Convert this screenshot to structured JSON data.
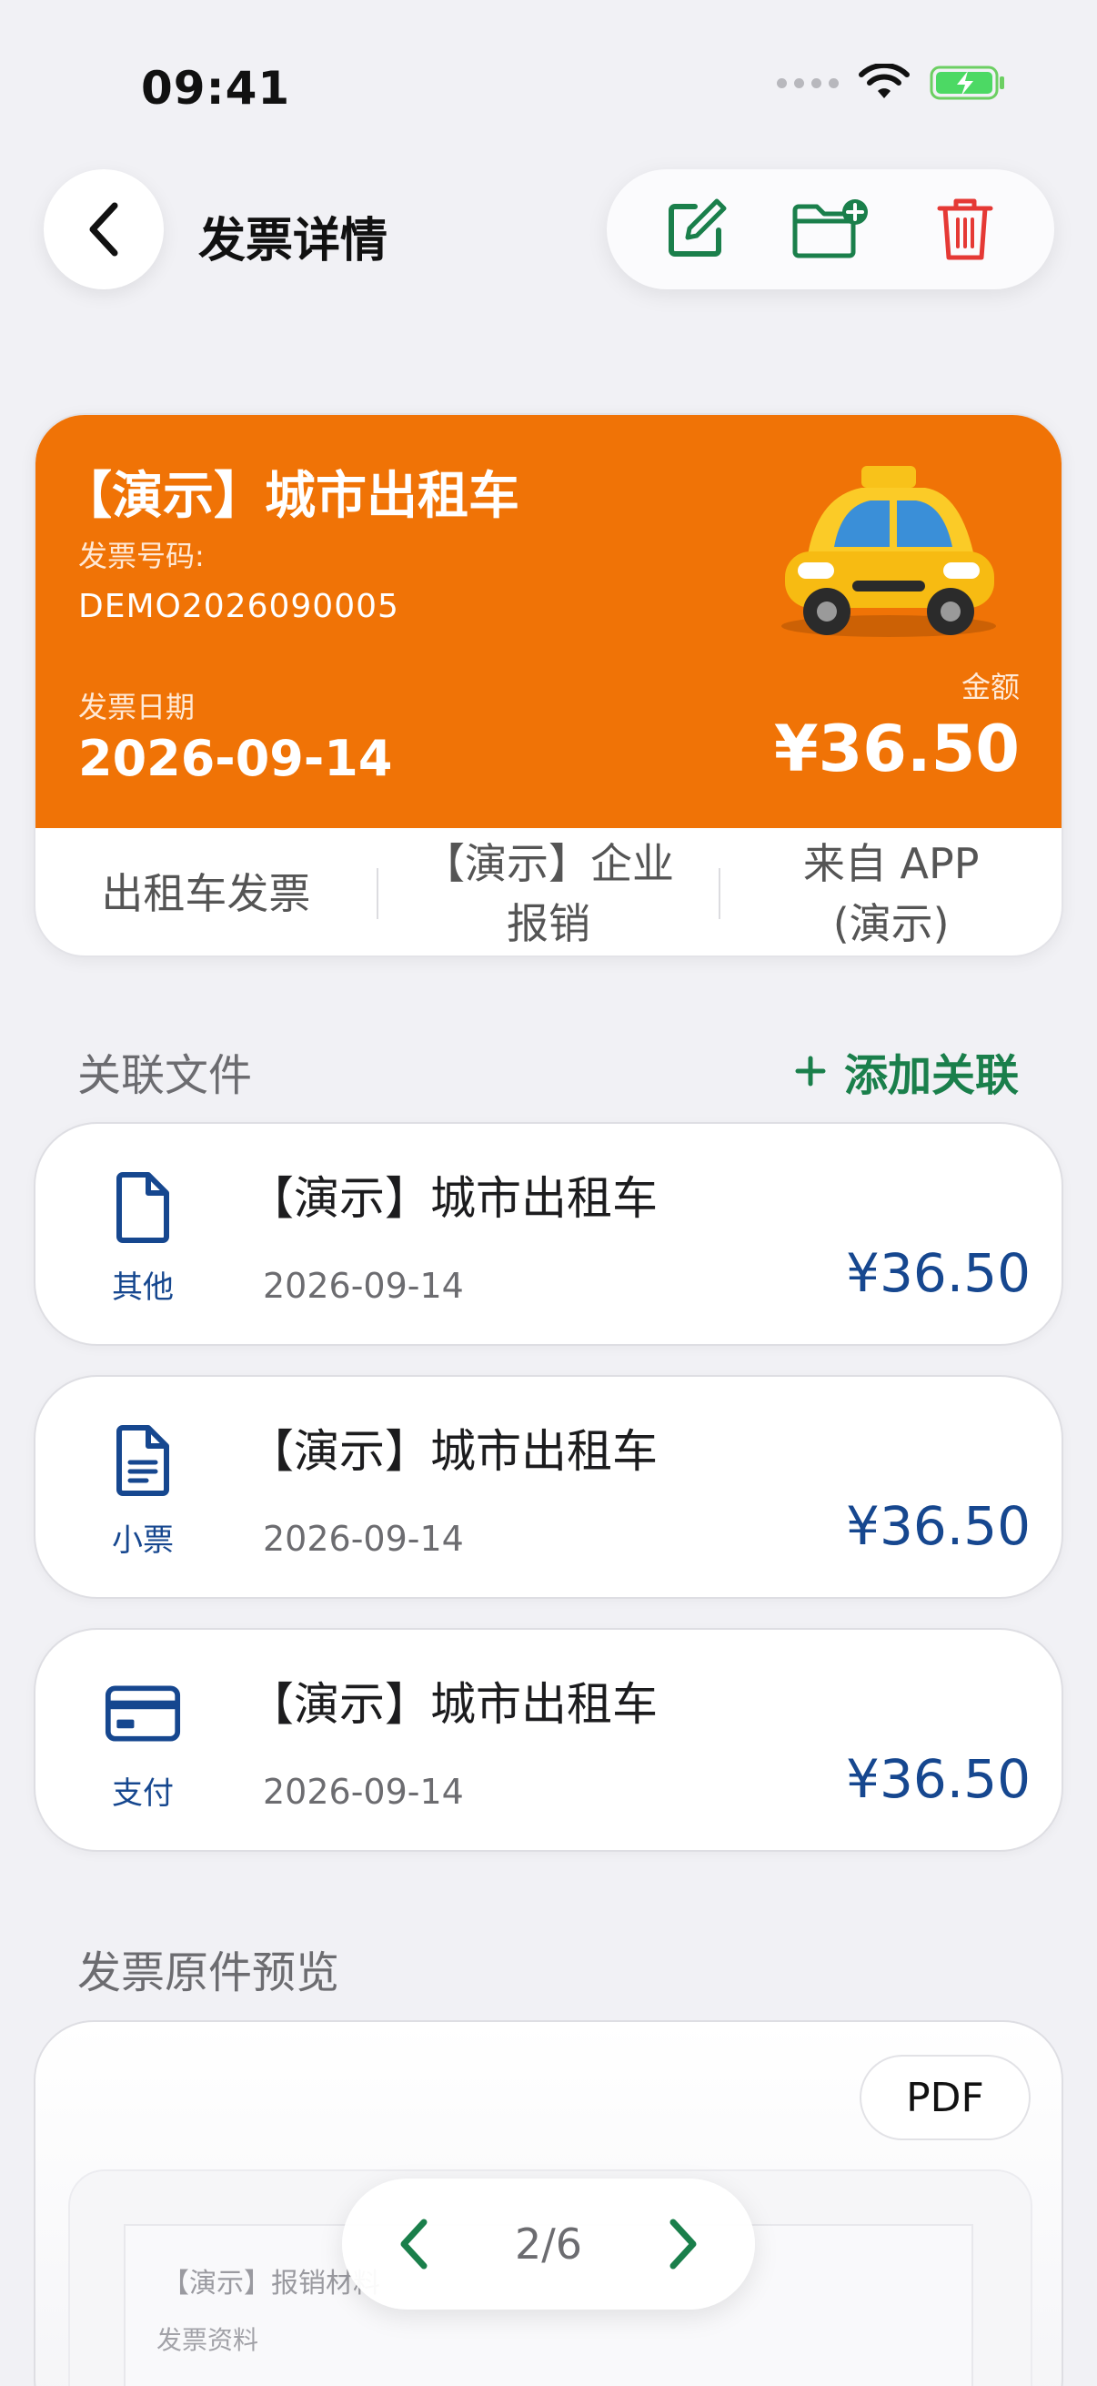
{
  "status_bar": {
    "time": "09:41"
  },
  "header": {
    "title": "发票详情"
  },
  "invoice": {
    "title": "【演示】城市出租车",
    "number_label": "发票号码:",
    "number": "DEMO2026090005",
    "date_label": "发票日期",
    "date": "2026-09-14",
    "amount_label": "金额",
    "amount": "¥36.50",
    "tags": [
      "出租车发票",
      "【演示】企业\n报销",
      "来自 APP\n(演示)"
    ],
    "accent_color": "#f07306"
  },
  "related": {
    "section_title": "关联文件",
    "add_label": "添加关联",
    "items": [
      {
        "type": "其他",
        "icon": "document-icon",
        "name": "【演示】城市出租车",
        "date": "2026-09-14",
        "amount": "¥36.50"
      },
      {
        "type": "小票",
        "icon": "receipt-icon",
        "name": "【演示】城市出租车",
        "date": "2026-09-14",
        "amount": "¥36.50"
      },
      {
        "type": "支付",
        "icon": "credit-card-icon",
        "name": "【演示】城市出租车",
        "date": "2026-09-14",
        "amount": "¥36.50"
      }
    ]
  },
  "preview": {
    "section_title": "发票原件预览",
    "format": "PDF",
    "doc_title": "【演示】报销材料",
    "doc_subtitle": "发票资料",
    "page_indicator": "2/6"
  },
  "colors": {
    "brand_green": "#1a7f4b",
    "delete_red": "#e53935",
    "amount_blue": "#16478f"
  }
}
